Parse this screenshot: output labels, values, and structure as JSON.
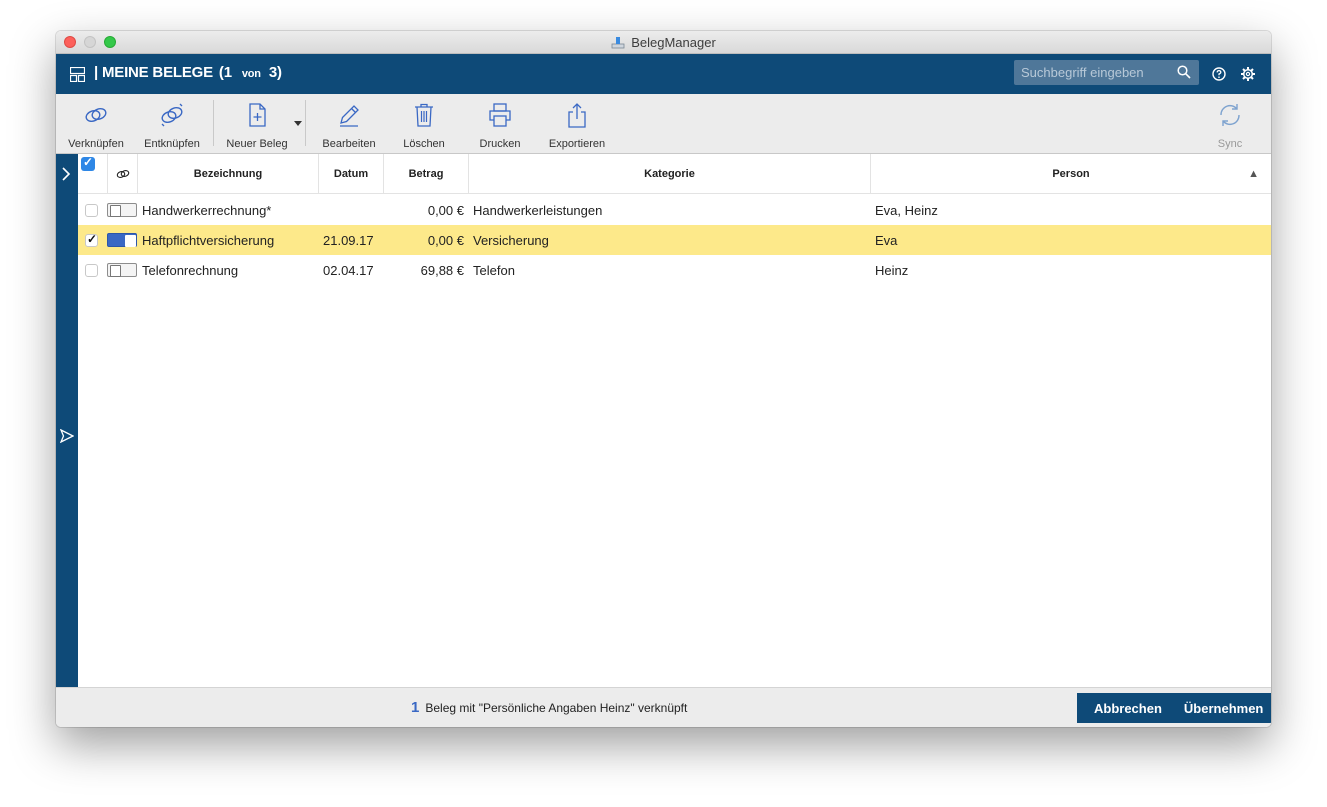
{
  "window": {
    "title": "BelegManager"
  },
  "header": {
    "title": "| MEINE BELEGE",
    "page_current": "(1",
    "page_sep": "von",
    "page_total": "3)",
    "search_placeholder": "Suchbegriff eingeben"
  },
  "toolbar": {
    "link": "Verknüpfen",
    "unlink": "Entknüpfen",
    "new": "Neuer Beleg",
    "edit": "Bearbeiten",
    "delete": "Löschen",
    "print": "Drucken",
    "export": "Exportieren",
    "sync": "Sync"
  },
  "table": {
    "columns": {
      "bezeichnung": "Bezeichnung",
      "datum": "Datum",
      "betrag": "Betrag",
      "kategorie": "Kategorie",
      "person": "Person",
      "sort_indicator": "▲"
    },
    "rows": [
      {
        "bezeichnung": "Handwerkerrechnung*",
        "datum": "",
        "betrag": "0,00 €",
        "kategorie": "Handwerkerleistungen",
        "person": "Eva, Heinz",
        "checked": false,
        "linked": false
      },
      {
        "bezeichnung": "Haftpflichtversicherung",
        "datum": "21.09.17",
        "betrag": "0,00 €",
        "kategorie": "Versicherung",
        "person": "Eva",
        "checked": true,
        "linked": true
      },
      {
        "bezeichnung": "Telefonrechnung",
        "datum": "02.04.17",
        "betrag": "69,88 €",
        "kategorie": "Telefon",
        "person": "Heinz",
        "checked": false,
        "linked": false
      }
    ]
  },
  "footer": {
    "count": "1",
    "status": "Beleg mit \"Persönliche Angaben Heinz\" verknüpft",
    "cancel": "Abbrechen",
    "apply": "Übernehmen"
  },
  "colors": {
    "primary": "#0e4a78",
    "selected_row": "#fde98a",
    "accent": "#3a68c4"
  }
}
